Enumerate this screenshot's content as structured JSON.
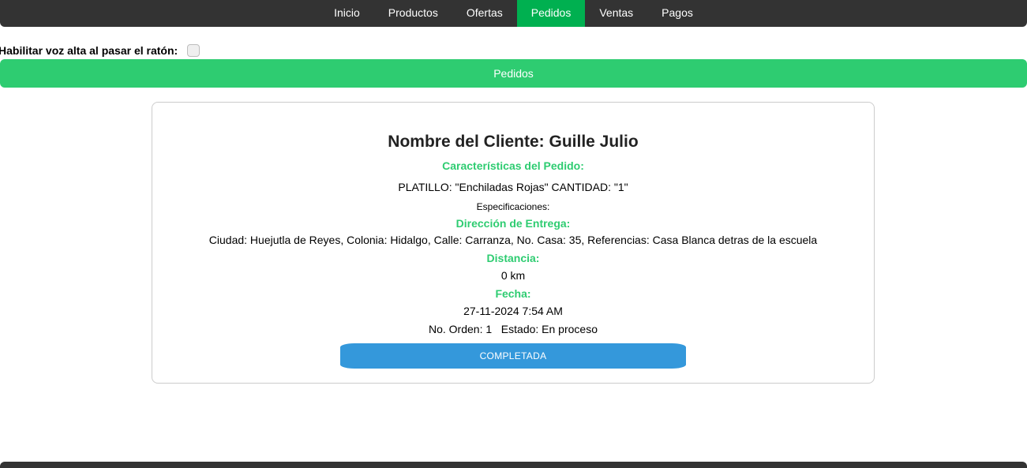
{
  "nav": {
    "items": [
      {
        "label": "Inicio"
      },
      {
        "label": "Productos"
      },
      {
        "label": "Ofertas"
      },
      {
        "label": "Pedidos"
      },
      {
        "label": "Ventas"
      },
      {
        "label": "Pagos"
      }
    ],
    "active_index": 3
  },
  "voice": {
    "label": "Habilitar voz alta al pasar el ratón:",
    "checked": false
  },
  "section": {
    "title": "Pedidos"
  },
  "order": {
    "client_heading": "Nombre del Cliente: Guille Julio",
    "features_label": "Características del Pedido:",
    "dish_line": "PLATILLO: \"Enchiladas Rojas\" CANTIDAD: \"1\"",
    "specs_label": "Especificaciones:",
    "delivery_label": "Dirección de Entrega:",
    "address": "Ciudad: Huejutla de Reyes, Colonia: Hidalgo, Calle: Carranza, No. Casa: 35, Referencias: Casa Blanca detras de la escuela",
    "distance_label": "Distancia:",
    "distance_value": "0 km",
    "date_label": "Fecha:",
    "date_value": "27-11-2024 7:54 AM",
    "status_line": "No. Orden: 1   Estado: En proceso",
    "complete_button": "COMPLETADA"
  },
  "colors": {
    "navbar": "#333333",
    "active_tab": "#00b050",
    "accent_green": "#2ecc71",
    "button_blue": "#3498db"
  }
}
